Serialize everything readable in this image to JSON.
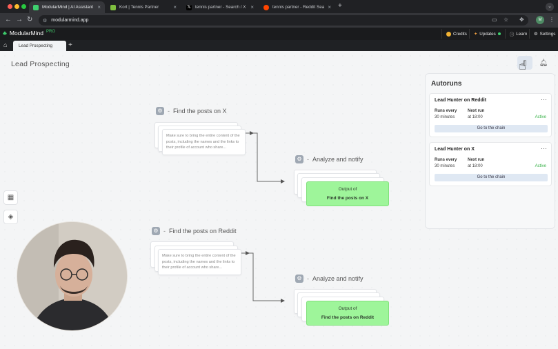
{
  "browser": {
    "tabs": [
      {
        "title": "ModularMind | AI Assistant",
        "active": true,
        "favicon_color": "#3ecf6e"
      },
      {
        "title": "Kort | Tennis Partner",
        "active": false,
        "favicon_color": "#7fbf3f"
      },
      {
        "title": "tennis partner - Search / X",
        "active": false,
        "favicon_color": "#ffffff"
      },
      {
        "title": "tennis partner - Reddit Search",
        "active": false,
        "favicon_color": "#ff4500"
      }
    ],
    "url": "modularmind.app",
    "profile_initial": "M"
  },
  "app": {
    "brand": "ModularMind",
    "pro": "PRO",
    "header_buttons": {
      "credits": "Credits",
      "updates": "Updates",
      "learn": "Learn",
      "settings": "Settings"
    },
    "page_tab": "Lead Prospecting"
  },
  "canvas": {
    "title": "Lead Prospecting",
    "flows": [
      {
        "find_title": "Find the posts on X",
        "prompt": "Make sure to bring the entire content of the posts, including the names and the links to their profile of account who share...",
        "analyze_title": "Analyze and notify",
        "output_label": "Output of",
        "output_source": "Find the posts on X"
      },
      {
        "find_title": "Find the posts on Reddit",
        "prompt": "Make sure to bring the entire content of the posts, including the names and the links to their profile of account who share...",
        "analyze_title": "Analyze and notify",
        "output_label": "Output of",
        "output_source": "Find the posts on Reddit"
      }
    ]
  },
  "autoruns": {
    "title": "Autoruns",
    "items": [
      {
        "name": "Lead Hunter on Reddit",
        "runs_label": "Runs every",
        "runs_value": "30 minutes",
        "next_label": "Next run",
        "next_value": "at 18:00",
        "status": "Active",
        "button": "Go to the chain"
      },
      {
        "name": "Lead Hunter on X",
        "runs_label": "Runs every",
        "runs_value": "30 minutes",
        "next_label": "Next run",
        "next_value": "at 18:00",
        "status": "Active",
        "button": "Go to the chain"
      }
    ]
  },
  "colors": {
    "accent_green": "#3ecf6e",
    "output_green": "#9ef59a",
    "active_status": "#3ab24a"
  }
}
